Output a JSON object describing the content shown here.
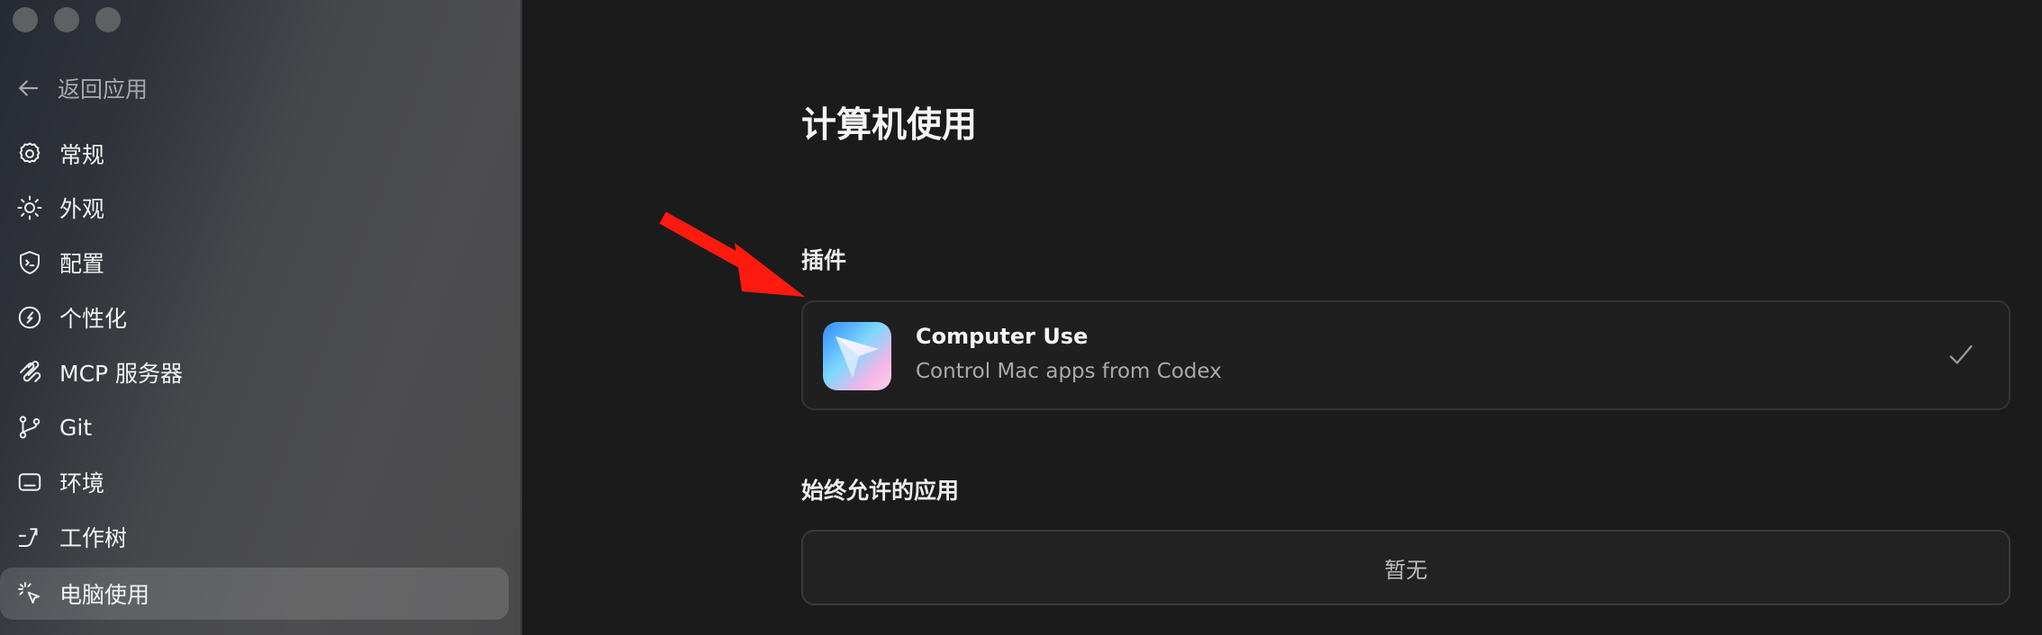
{
  "sidebar": {
    "back_label": "返回应用",
    "items": [
      {
        "label": "常规",
        "icon": "gear-icon"
      },
      {
        "label": "外观",
        "icon": "sun-icon"
      },
      {
        "label": "配置",
        "icon": "shield-terminal-icon"
      },
      {
        "label": "个性化",
        "icon": "personalization-icon"
      },
      {
        "label": "MCP 服务器",
        "icon": "mcp-icon"
      },
      {
        "label": "Git",
        "icon": "git-branch-icon"
      },
      {
        "label": "环境",
        "icon": "terminal-window-icon"
      },
      {
        "label": "工作树",
        "icon": "worktree-icon"
      },
      {
        "label": "电脑使用",
        "icon": "cursor-click-icon",
        "active": true
      }
    ]
  },
  "main": {
    "title": "计算机使用",
    "plugins_section": {
      "title": "插件",
      "plugin": {
        "name": "Computer Use",
        "description": "Control Mac apps from Codex",
        "enabled": true,
        "icon": "computer-use-logo"
      }
    },
    "allowed_apps_section": {
      "title": "始终允许的应用",
      "empty_text": "暂无"
    }
  },
  "colors": {
    "annotation_arrow": "#ff1a0f",
    "background": "#1b1b1b",
    "sidebar_active": "#5a5a5c"
  }
}
